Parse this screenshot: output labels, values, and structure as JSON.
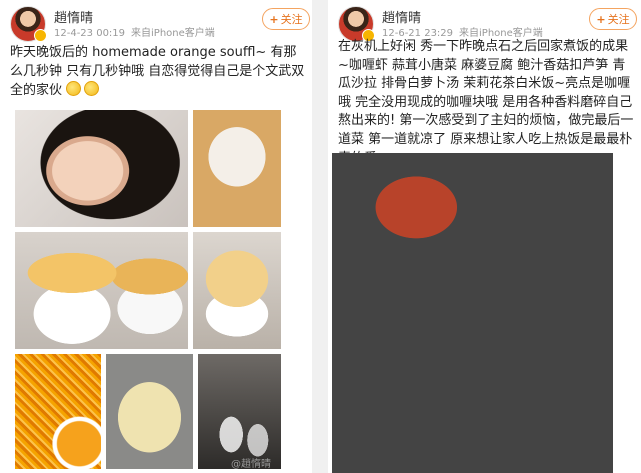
{
  "left_post": {
    "username": "趙惰晴",
    "date": "12-4-23 00:19",
    "source": "来自iPhone客户端",
    "follow_label": "关注",
    "text": "昨天晚饭后的 homemade orange souffl~ 有那么几秒钟 只有几秒钟哦 自恋得觉得自己是个文武双全的家伙",
    "photos": [
      "woman-smiling-photo",
      "souffle-top-view-photo",
      "two-souffles-photo",
      "single-souffle-photo",
      "orange-zest-photo",
      "batter-pot-photo",
      "glasses-photo"
    ]
  },
  "right_post": {
    "username": "趙惰晴",
    "date": "12-6-21 23:29",
    "source": "来自iPhone客户端",
    "follow_label": "关注",
    "text": "在灰机上好闲 秀一下昨晚点石之后回家煮饭的成果~咖喱虾 蒜茸小唐菜 麻婆豆腐 鲍汁香菇扣芦笋 青瓜沙拉 排骨白萝卜汤 茉莉花茶白米饭~亮点是咖喱哦 完全没用现成的咖喱块哦 是用各种香料磨碎自己熬出来的! 第一次感受到了主妇的烦恼，做完最后一道菜 第一道就凉了 原来想让家人吃上热饭是最最朴素的爱"
  },
  "watermark": "@趙惰晴",
  "icons": {
    "follow": "plus-icon",
    "emoji": "smiley-emoji-icon",
    "vip": "vip-badge-icon"
  }
}
